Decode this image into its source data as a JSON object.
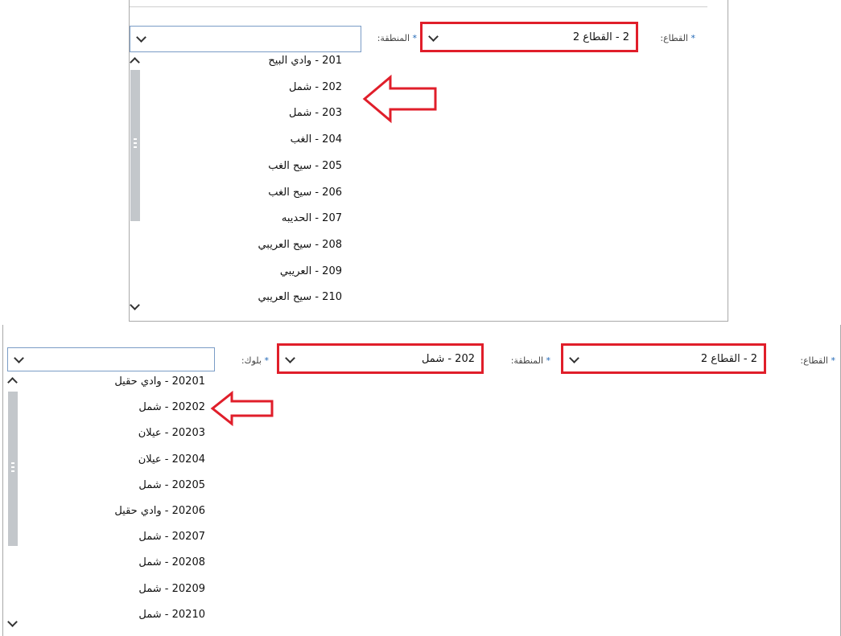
{
  "top_panel": {
    "sector_label": "القطاع:",
    "sector_value": "2 - القطاع 2",
    "region_label": "المنطقة:",
    "region_value": "",
    "required_mark": "*",
    "region_options": [
      "201 - وادي البيح",
      "202 - شمل",
      "203 - شمل",
      "204 - الغب",
      "205 - سيح الغب",
      "206 - سيح الغب",
      "207 - الحديبه",
      "208 - سيح العريبي",
      "209 - العريبي",
      "210 - سيح العريبي"
    ]
  },
  "bottom_panel": {
    "sector_label": "القطاع:",
    "sector_value": "2 - القطاع 2",
    "region_label": "المنطقة:",
    "region_value": "202 - شمل",
    "block_label": "بلوك:",
    "block_value": "",
    "required_mark": "*",
    "block_options": [
      "20201 - وادي حقيل",
      "20202 - شمل",
      "20203 - عيلان",
      "20204 - عيلان",
      "20205 - شمل",
      "20206 - وادي حقيل",
      "20207 - شمل",
      "20208 - شمل",
      "20209 - شمل",
      "20210 - شمل"
    ]
  },
  "colors": {
    "highlight": "#e01e2a",
    "select_border": "#7a9cc6",
    "required": "#1f66b5",
    "scroll_thumb": "#c3c7cb"
  },
  "icons": {
    "dropdown": "chevron-down-icon",
    "scroll_up": "chevron-up-icon",
    "scroll_down": "chevron-down-icon",
    "annotation": "left-arrow-annotation-icon"
  }
}
